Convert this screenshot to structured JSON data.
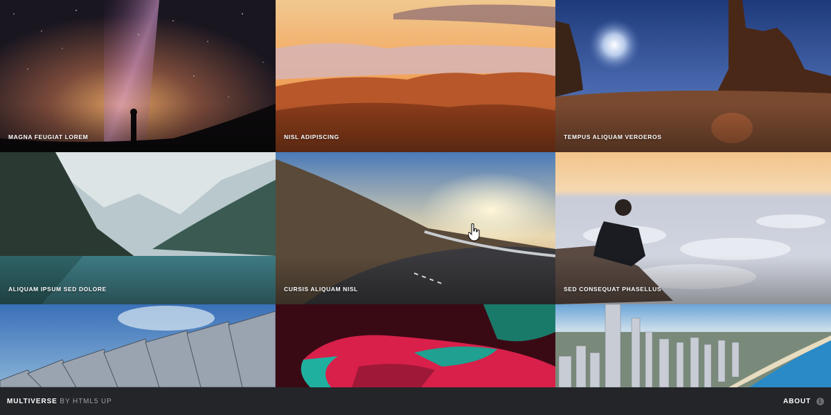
{
  "gallery": {
    "items": [
      {
        "caption": "MAGNA FEUGIAT LOREM",
        "image": "starry-sky-milky-way-person-silhouette"
      },
      {
        "caption": "NISL ADIPISCING",
        "image": "sunset-mountains-above-clouds"
      },
      {
        "caption": "TEMPUS ALIQUAM VEROEROS",
        "image": "desert-rock-formations-sun"
      },
      {
        "caption": "ALIQUAM IPSUM SED DOLORE",
        "image": "mountain-lake-reflection"
      },
      {
        "caption": "CURSIS ALIQUAM NISL",
        "image": "winding-road-sunset"
      },
      {
        "caption": "SED CONSEQUAT PHASELLUS",
        "image": "man-sitting-above-sea-of-clouds"
      },
      {
        "caption": "",
        "image": "modern-building-facade-blue-sky"
      },
      {
        "caption": "",
        "image": "hands-abstract-red-teal"
      },
      {
        "caption": "",
        "image": "city-skyline-coast-aerial"
      }
    ]
  },
  "footer": {
    "brand_name": "MULTIVERSE",
    "brand_by": "BY HTML5 UP",
    "about_label": "ABOUT",
    "info_icon_glyph": "i"
  },
  "colors": {
    "footer_bg": "#242529",
    "page_bg": "#1e1f23",
    "caption_text": "#ffffff"
  },
  "icons": {
    "info": "info-circle-icon",
    "cursor": "hand-pointer-icon"
  }
}
